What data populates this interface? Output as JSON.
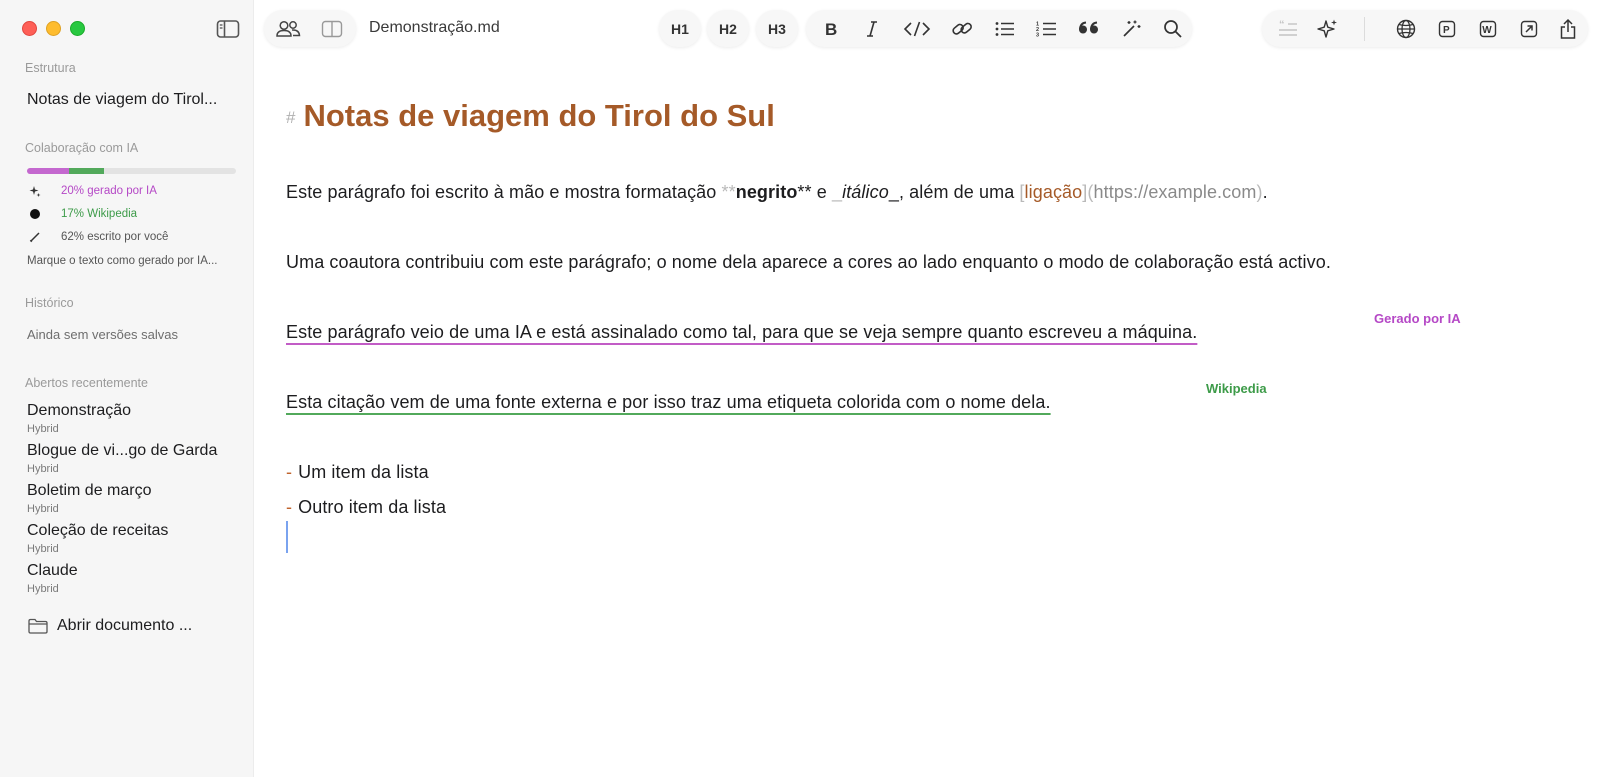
{
  "window": {
    "doc_title": "Demonstração.md"
  },
  "toolbar": {
    "headings": [
      "H1",
      "H2",
      "H3"
    ],
    "format_icons": [
      "bold-icon",
      "italic-icon",
      "code-icon",
      "link-icon",
      "bulleted-list-icon",
      "numbered-list-icon",
      "quote-icon",
      "magic-wand-icon",
      "search-icon"
    ],
    "right_icons": [
      "quote-disabled-icon",
      "sparkles-icon",
      "globe-icon",
      "pdf-export-icon",
      "word-export-icon",
      "open-external-icon",
      "share-icon"
    ]
  },
  "sidebar": {
    "structure": {
      "label": "Estrutura",
      "item": "Notas de viagem do Tirol..."
    },
    "ai_collab": {
      "label": "Colaboração com IA",
      "ai_share": 0.2,
      "wiki_share": 0.17,
      "you_share": 0.62,
      "rows": [
        {
          "text": "20% gerado por IA",
          "color": "#b548c6",
          "icon": "sparkle-icon"
        },
        {
          "text": "17% Wikipedia",
          "color": "#3d9b49",
          "icon": "dot-icon"
        },
        {
          "text": "62% escrito por você",
          "color": "#555555",
          "icon": "pencil-icon"
        }
      ],
      "mark_ai": "Marque o texto como gerado por IA..."
    },
    "history": {
      "label": "Histórico",
      "empty": "Ainda sem versões salvas"
    },
    "recent": {
      "label": "Abertos recentemente",
      "items": [
        {
          "title": "Demonstração",
          "sub": "Hybrid"
        },
        {
          "title": "Blogue de vi...go de Garda",
          "sub": "Hybrid"
        },
        {
          "title": "Boletim de março",
          "sub": "Hybrid"
        },
        {
          "title": "Coleção de receitas",
          "sub": "Hybrid"
        },
        {
          "title": "Claude",
          "sub": "Hybrid"
        }
      ]
    },
    "open_doc": "Abrir documento ..."
  },
  "editor": {
    "h1_hash": "#",
    "h1": "Notas de viagem do Tirol do Sul",
    "p1": {
      "a": "Este parágrafo foi escrito à mão e mostra formatação ",
      "bold_mark": "**",
      "bold": "negrito",
      "b": " e ",
      "ital_mark": "_",
      "italic": "itálico",
      "c": ", além de uma ",
      "lb_open": "[",
      "link": "ligação",
      "lb_close": "]",
      "paren_open": "(",
      "url": "https://example.com",
      "paren_close": ")",
      "end": "."
    },
    "p2": "Uma coautora contribuiu com este parágrafo; o nome dela aparece a cores ao lado enquanto o modo de colaboração está activo.",
    "p3": "Este parágrafo veio de uma IA e está assinalado como tal, para que se veja sempre quanto escreveu a máquina.",
    "p3_tag": "Gerado por IA",
    "p4": "Esta citação vem de uma fonte externa e por isso traz uma etiqueta colorida com o nome dela.",
    "p4_tag": "Wikipedia",
    "bullet_mark": "-",
    "list": [
      "Um item da lista",
      "Outro item da lista"
    ]
  },
  "colors": {
    "accent": "#a55a28",
    "ai": "#b548c6",
    "wiki": "#3d9b49",
    "caret": "#7aa3ef"
  }
}
